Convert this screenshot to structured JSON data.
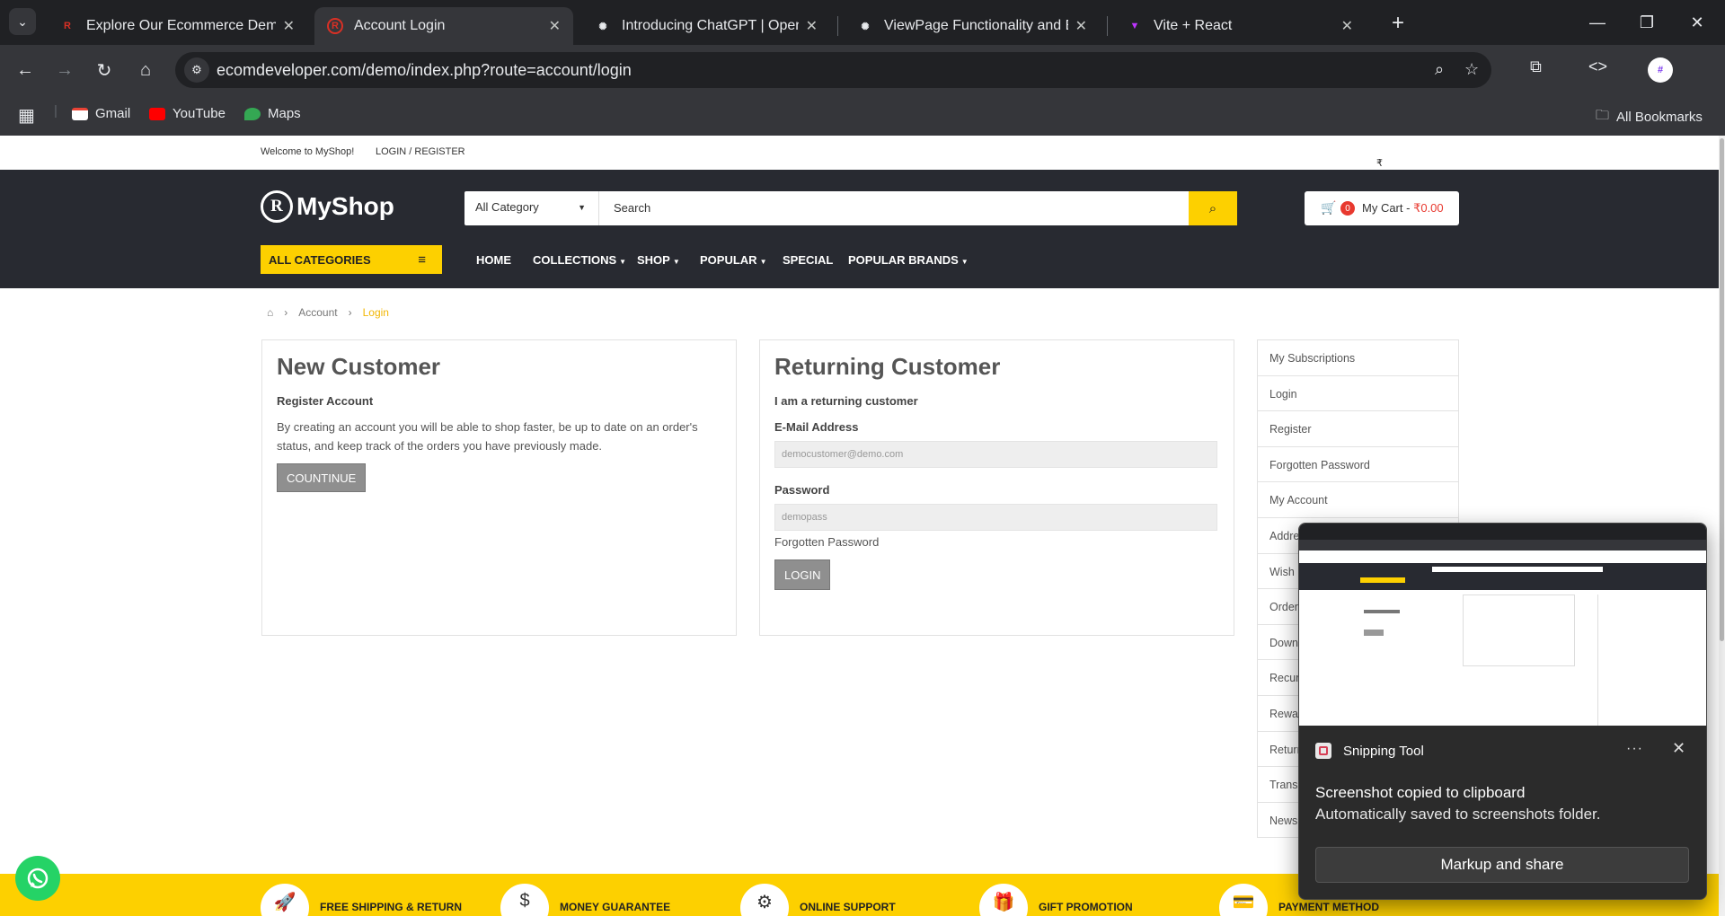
{
  "browser": {
    "tabs": [
      {
        "title": "Explore Our Ecommerce Demo",
        "active": false
      },
      {
        "title": "Account Login",
        "active": true
      },
      {
        "title": "Introducing ChatGPT | OpenAI",
        "active": false
      },
      {
        "title": "ViewPage Functionality and Enh",
        "active": false
      },
      {
        "title": "Vite + React",
        "active": false
      }
    ],
    "url": "ecomdeveloper.com/demo/index.php?route=account/login",
    "bookmarks": [
      "Gmail",
      "YouTube",
      "Maps"
    ],
    "all_bookmarks": "All Bookmarks"
  },
  "site": {
    "welcome": "Welcome to MyShop!",
    "login_register": "LOGIN / REGISTER",
    "currency": "₹ Indian Rupees",
    "logo_text": "MyShop",
    "search": {
      "category": "All Category",
      "placeholder": "Search"
    },
    "cart": {
      "count": "0",
      "label": "My Cart - ",
      "value": "₹0.00"
    },
    "all_categories": "ALL CATEGORIES",
    "menu": [
      "HOME",
      "COLLECTIONS",
      "SHOP",
      "POPULAR",
      "SPECIAL",
      "POPULAR BRANDS"
    ]
  },
  "breadcrumb": {
    "account": "Account",
    "current": "Login"
  },
  "new_customer": {
    "title": "New Customer",
    "subtitle": "Register Account",
    "text": "By creating an account you will be able to shop faster, be up to date on an order's status, and keep track of the orders you have previously made.",
    "button": "COUNTINUE"
  },
  "returning_customer": {
    "title": "Returning Customer",
    "subtitle": "I am a returning customer",
    "email_label": "E-Mail Address",
    "email_value": "democustomer@demo.com",
    "password_label": "Password",
    "password_value": "demopass",
    "forgotten": "Forgotten Password",
    "button": "LOGIN"
  },
  "account_links": [
    "My Subscriptions",
    "Login",
    "Register",
    "Forgotten Password",
    "My Account",
    "Address Book",
    "Wish List",
    "Order History",
    "Downloads",
    "Recurring payments",
    "Reward Points",
    "Returns",
    "Transactions",
    "Newsletter"
  ],
  "features": [
    "FREE SHIPPING & RETURN",
    "MONEY GUARANTEE",
    "ONLINE SUPPORT",
    "GIFT PROMOTION",
    "PAYMENT METHOD"
  ],
  "snipping_tool": {
    "app": "Snipping Tool",
    "message": "Screenshot copied to clipboard",
    "detail": "Automatically saved to screenshots folder.",
    "action": "Markup and share"
  },
  "colors": {
    "accent": "#fdd000",
    "header_bg": "#282a31",
    "chrome_bg": "#35363a"
  }
}
